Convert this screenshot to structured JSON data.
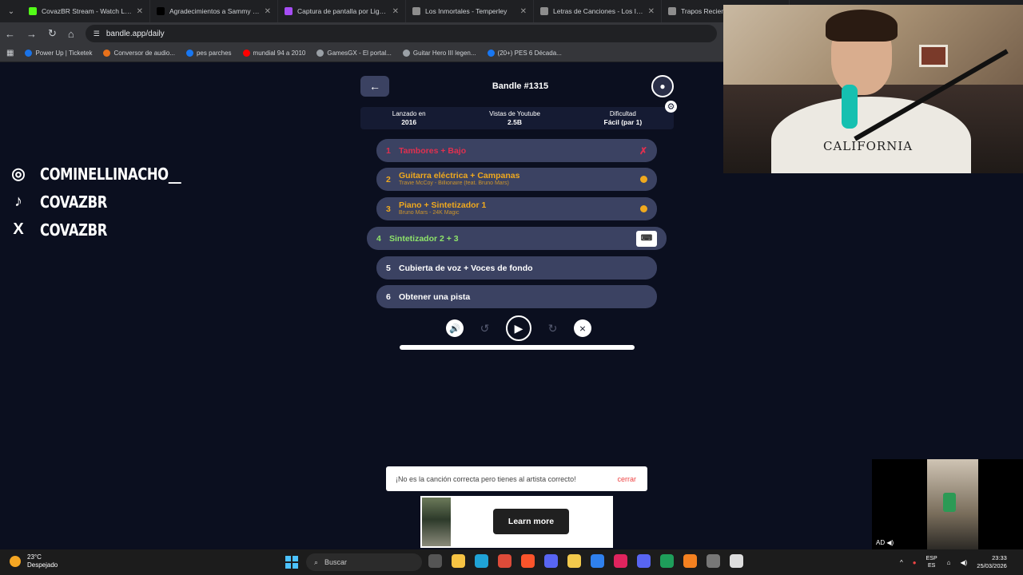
{
  "browser": {
    "tabs": [
      {
        "title": "CovazBR Stream - Watch Live o",
        "color": "#53fc18",
        "active": false
      },
      {
        "title": "Agradecimientos a Sammy por",
        "color": "#000000",
        "active": false
      },
      {
        "title": "Captura de pantalla por Lightsh",
        "color": "#a64df5",
        "active": false
      },
      {
        "title": "Los Inmortales - Temperley",
        "color": "#8d8d8d",
        "active": false
      },
      {
        "title": "Letras de Canciones - Los Inmo",
        "color": "#8d8d8d",
        "active": false
      },
      {
        "title": "Trapos Recientes",
        "color": "#8d8d8d",
        "active": false
      }
    ],
    "url": "bandle.app/daily",
    "bookmarks": [
      {
        "label": "Power Up | Ticketek",
        "color": "#1a73e8"
      },
      {
        "label": "Conversor de audio...",
        "color": "#e8711a"
      },
      {
        "label": "pes parches",
        "color": "#1877f2"
      },
      {
        "label": "mundial 94 a 2010",
        "color": "#ff0000"
      },
      {
        "label": "GamesGX - El portal...",
        "color": "#9aa0a6"
      },
      {
        "label": "Guitar Hero III legen...",
        "color": "#9aa0a6"
      },
      {
        "label": "(20+) PES 6 Década...",
        "color": "#1877f2"
      }
    ]
  },
  "overlay": {
    "socials": [
      {
        "icon": "instagram-icon",
        "glyph": "◎",
        "handle": "COMINELLINACHO__"
      },
      {
        "icon": "tiktok-icon",
        "glyph": "♪",
        "handle": "COVAZBR"
      },
      {
        "icon": "x-icon",
        "glyph": "X",
        "handle": "COVAZBR"
      }
    ],
    "webcam_shirt_text": "CALIFORNIA"
  },
  "game": {
    "title": "Bandle #1315",
    "stats": [
      {
        "label": "Lanzado en",
        "value": "2016"
      },
      {
        "label": "Vistas de Youtube",
        "value": "2.5B"
      },
      {
        "label": "Dificultad",
        "value": "Fácil (par 1)"
      }
    ],
    "tracks": [
      {
        "num": "1",
        "label": "Tambores + Bajo",
        "sub": "",
        "state": "fail",
        "marker": "✗"
      },
      {
        "num": "2",
        "label": "Guitarra eléctrica + Campanas",
        "sub": "Travie McCoy - Billionaire (feat. Bruno Mars)",
        "state": "partial",
        "marker": ""
      },
      {
        "num": "3",
        "label": "Piano + Sintetizador 1",
        "sub": "Bruno Mars - 24K Magic",
        "state": "partial",
        "marker": ""
      },
      {
        "num": "4",
        "label": "Sintetizador 2 + 3",
        "sub": "",
        "state": "current",
        "marker": ""
      },
      {
        "num": "5",
        "label": "Cubierta de voz + Voces de fondo",
        "sub": "",
        "state": "locked",
        "marker": ""
      },
      {
        "num": "6",
        "label": "Obtener una pista",
        "sub": "",
        "state": "hint",
        "marker": ""
      }
    ],
    "progress": 1.0
  },
  "toast": {
    "message": "¡No es la canción correcta pero tienes al artista correcto!",
    "close_label": "cerrar"
  },
  "ad": {
    "cta": "Learn more"
  },
  "taskbar": {
    "temp": "23°C",
    "weather": "Despejado",
    "search_placeholder": "Buscar",
    "lang_top": "ESP",
    "lang_bottom": "ES",
    "time": "23:33",
    "date": "25/03/2026"
  }
}
